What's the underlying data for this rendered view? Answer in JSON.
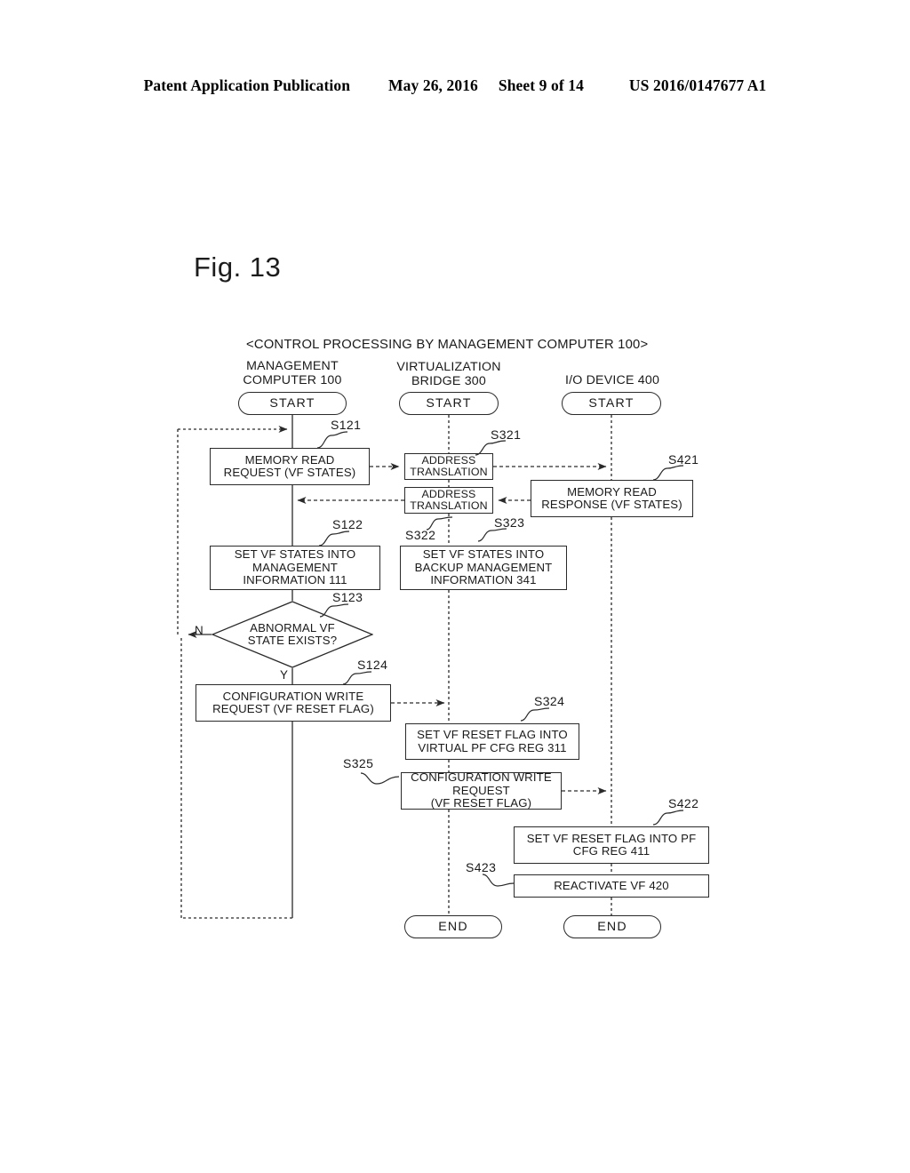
{
  "header": {
    "publication": "Patent Application Publication",
    "date": "May 26, 2016",
    "sheet": "Sheet 9 of 14",
    "patent_number": "US 2016/0147677 A1"
  },
  "figure": {
    "label": "Fig. 13",
    "title": "<CONTROL PROCESSING BY MANAGEMENT COMPUTER 100>"
  },
  "lanes": [
    {
      "id": "management-computer",
      "title": "MANAGEMENT\nCOMPUTER 100"
    },
    {
      "id": "virtualization-bridge",
      "title": "VIRTUALIZATION\nBRIDGE 300"
    },
    {
      "id": "io-device",
      "title": "I/O DEVICE 400"
    }
  ],
  "nodes": {
    "start1": "START",
    "start2": "START",
    "start3": "START",
    "s121": "MEMORY READ\nREQUEST (VF STATES)",
    "s321": "ADDRESS\nTRANSLATION",
    "s421": "MEMORY READ\nRESPONSE (VF STATES)",
    "s323": "ADDRESS\nTRANSLATION",
    "s122": "SET VF STATES INTO\nMANAGEMENT\nINFORMATION 111",
    "s322": "SET VF STATES INTO\nBACKUP MANAGEMENT\nINFORMATION 341",
    "s123": "ABNORMAL VF\nSTATE EXISTS?",
    "s124": "CONFIGURATION WRITE\nREQUEST (VF RESET FLAG)",
    "s324": "SET VF RESET FLAG INTO\nVIRTUAL PF CFG REG 311",
    "s325": "CONFIGURATION WRITE\nREQUEST\n(VF RESET FLAG)",
    "s422": "SET VF RESET FLAG INTO PF\nCFG REG 411",
    "s423": "REACTIVATE VF 420",
    "end2": "END",
    "end3": "END"
  },
  "step_tags": {
    "s121": "S121",
    "s321": "S321",
    "s421": "S421",
    "s122": "S122",
    "s322": "S322",
    "s323": "S323",
    "s123": "S123",
    "s124": "S124",
    "s324": "S324",
    "s325": "S325",
    "s422": "S422",
    "s423": "S423"
  },
  "branch_labels": {
    "no": "N",
    "yes": "Y"
  },
  "colors": {
    "ink": "#1a1a1a",
    "stroke": "#2a2a2a",
    "paper": "#ffffff"
  }
}
